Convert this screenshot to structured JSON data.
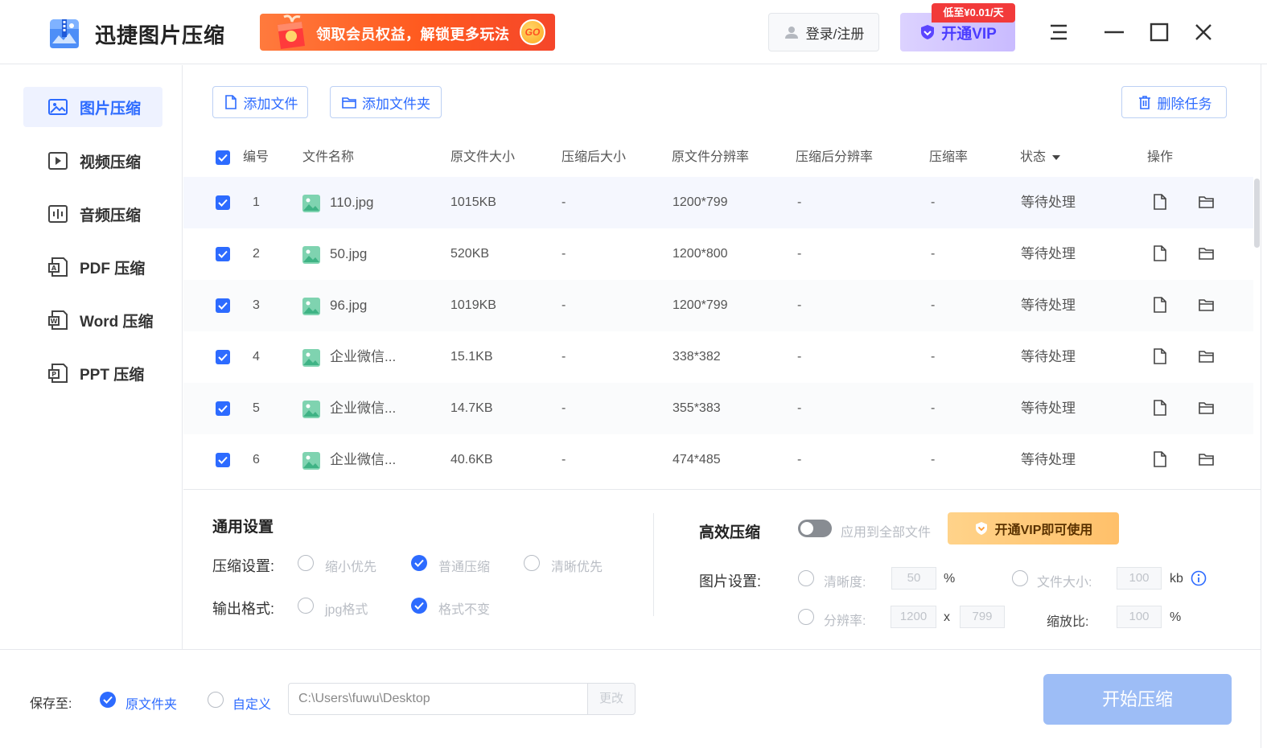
{
  "app": {
    "title": "迅捷图片压缩",
    "promo_text": "领取会员权益，解锁更多玩法",
    "promo_go": "GO",
    "login_label": "登录/注册",
    "vip_label": "开通VIP",
    "vip_tag": "低至¥0.01/天"
  },
  "sidebar": {
    "items": [
      {
        "label": "图片压缩",
        "icon": "image-icon",
        "active": true
      },
      {
        "label": "视频压缩",
        "icon": "video-icon"
      },
      {
        "label": "音频压缩",
        "icon": "audio-icon"
      },
      {
        "label": "PDF 压缩",
        "icon": "pdf-icon"
      },
      {
        "label": "Word 压缩",
        "icon": "word-icon"
      },
      {
        "label": "PPT 压缩",
        "icon": "ppt-icon"
      }
    ]
  },
  "toolbar": {
    "add_file": "添加文件",
    "add_folder": "添加文件夹",
    "delete_task": "删除任务"
  },
  "table": {
    "columns": [
      "编号",
      "文件名称",
      "原文件大小",
      "压缩后大小",
      "原文件分辨率",
      "压缩后分辨率",
      "压缩率",
      "状态",
      "操作"
    ],
    "rows": [
      {
        "no": "1",
        "name": "110.jpg",
        "size": "1015KB",
        "csize": "-",
        "res": "1200*799",
        "cres": "-",
        "rate": "-",
        "status": "等待处理"
      },
      {
        "no": "2",
        "name": "50.jpg",
        "size": "520KB",
        "csize": "-",
        "res": "1200*800",
        "cres": "-",
        "rate": "-",
        "status": "等待处理"
      },
      {
        "no": "3",
        "name": "96.jpg",
        "size": "1019KB",
        "csize": "-",
        "res": "1200*799",
        "cres": "-",
        "rate": "-",
        "status": "等待处理"
      },
      {
        "no": "4",
        "name": "企业微信...",
        "size": "15.1KB",
        "csize": "-",
        "res": "338*382",
        "cres": "-",
        "rate": "-",
        "status": "等待处理"
      },
      {
        "no": "5",
        "name": "企业微信...",
        "size": "14.7KB",
        "csize": "-",
        "res": "355*383",
        "cres": "-",
        "rate": "-",
        "status": "等待处理"
      },
      {
        "no": "6",
        "name": "企业微信...",
        "size": "40.6KB",
        "csize": "-",
        "res": "474*485",
        "cres": "-",
        "rate": "-",
        "status": "等待处理"
      }
    ]
  },
  "general": {
    "title": "通用设置",
    "compress_label": "压缩设置:",
    "compress_options": [
      "缩小优先",
      "普通压缩",
      "清晰优先"
    ],
    "compress_selected": "普通压缩",
    "format_label": "输出格式:",
    "format_options": [
      "jpg格式",
      "格式不变"
    ],
    "format_selected": "格式不变"
  },
  "efficient": {
    "title": "高效压缩",
    "apply_all": "应用到全部文件",
    "apply_all_on": false,
    "vip_use": "开通VIP即可使用",
    "image_label": "图片设置:",
    "clarity_label": "清晰度:",
    "clarity_value": "50",
    "clarity_unit": "%",
    "filesize_label": "文件大小:",
    "filesize_value": "100",
    "filesize_unit": "kb",
    "resolution_label": "分辨率:",
    "res_w": "1200",
    "res_x": "x",
    "res_h": "799",
    "scale_label": "缩放比:",
    "scale_value": "100",
    "scale_unit": "%"
  },
  "footer": {
    "save_to": "保存至:",
    "original_folder": "原文件夹",
    "custom": "自定义",
    "save_selected": "原文件夹",
    "path": "C:\\Users\\fuwu\\Desktop",
    "change": "更改",
    "start": "开始压缩"
  },
  "colors": {
    "accent": "#2d6bff",
    "promo": "#ff5a1f",
    "vip_text": "#4a3cff",
    "start_button": "#9dbdf6"
  }
}
